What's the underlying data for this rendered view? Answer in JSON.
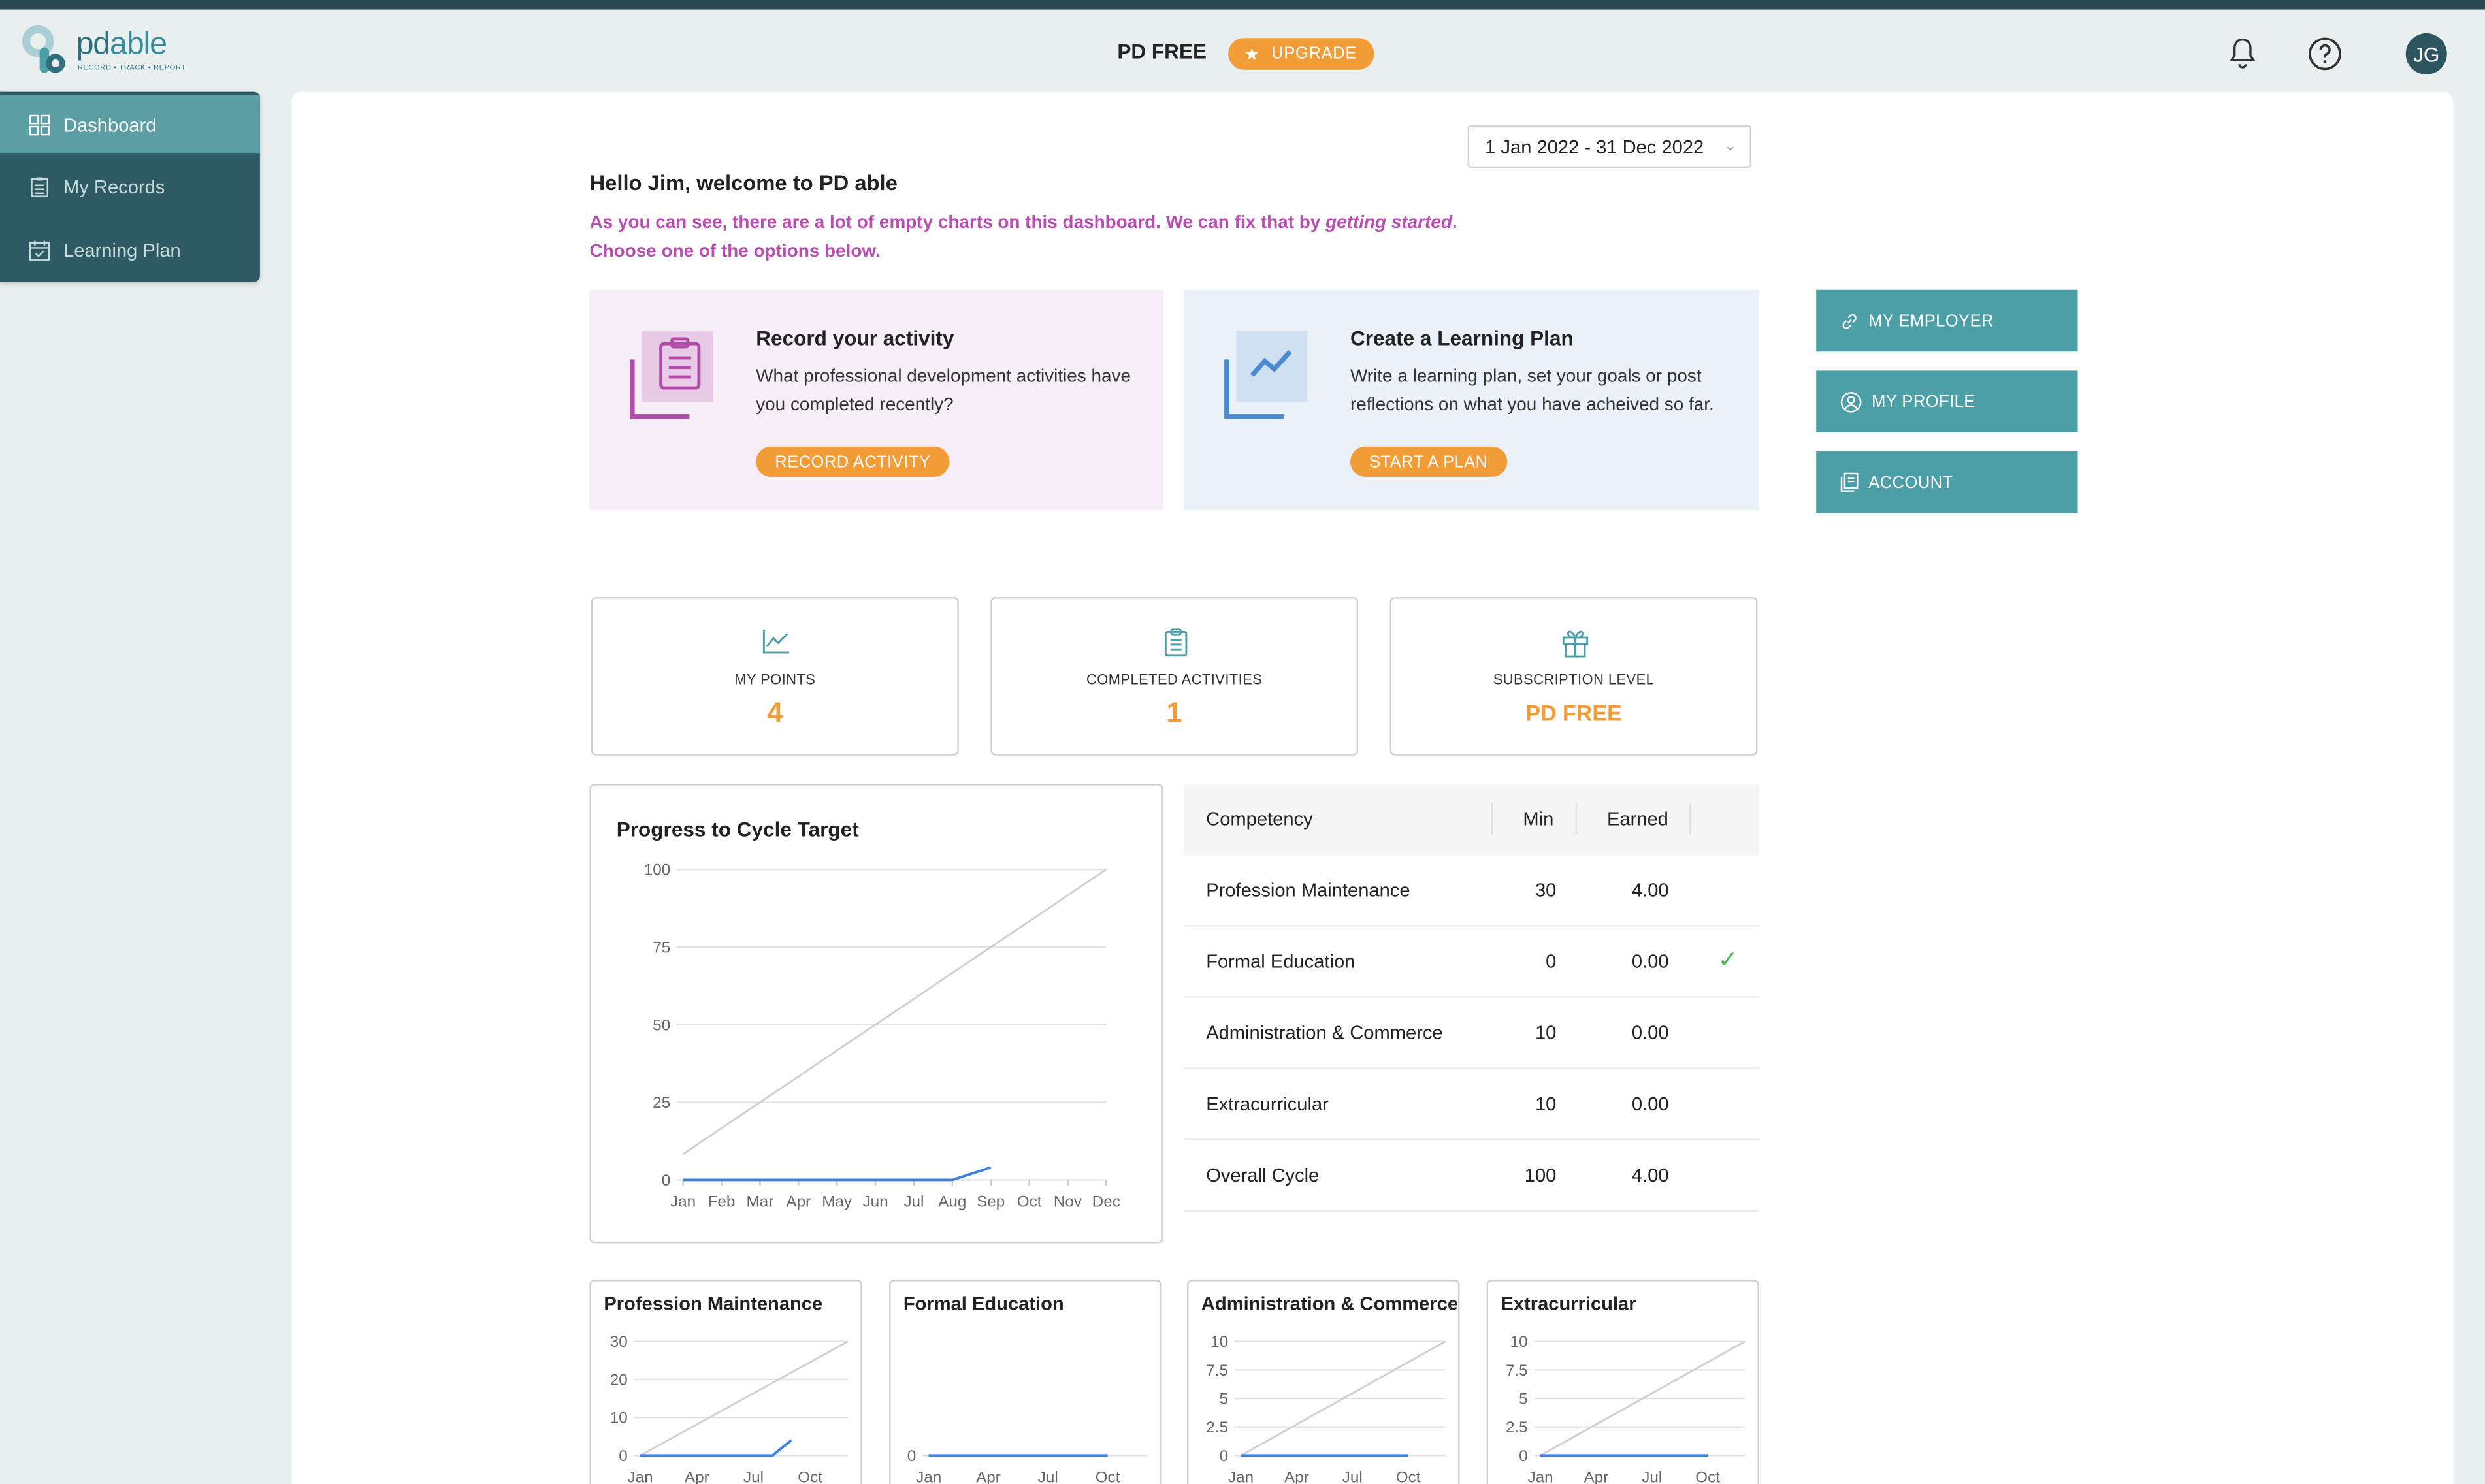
{
  "header": {
    "logo_text_a": "pd",
    "logo_text_b": "able",
    "logo_tagline": "RECORD • TRACK • REPORT",
    "plan_label": "PD FREE",
    "upgrade_label": "UPGRADE",
    "avatar_initials": "JG",
    "icons": [
      "bell-icon",
      "help-icon"
    ]
  },
  "sidebar": {
    "items": [
      {
        "label": "Dashboard",
        "icon": "dashboard-icon",
        "active": true
      },
      {
        "label": "My Records",
        "icon": "records-icon",
        "active": false
      },
      {
        "label": "Learning Plan",
        "icon": "calendar-icon",
        "active": false
      }
    ]
  },
  "main": {
    "date_range": "1 Jan 2022 - 31 Dec 2022",
    "greeting": "Hello Jim, welcome to PD able",
    "intro_line1_a": "As you can see, there are a lot of empty charts on this dashboard. We can fix that by ",
    "intro_line1_em": "getting started",
    "intro_line1_b": ".",
    "intro_line2": "Choose one of the options below."
  },
  "cards": {
    "record": {
      "title": "Record your activity",
      "desc": "What professional development activities have you completed recently?",
      "button": "RECORD ACTIVITY"
    },
    "plan": {
      "title": "Create a Learning Plan",
      "desc": "Write a learning plan, set your goals or post reflections on what you have acheived so far.",
      "button": "START A PLAN"
    }
  },
  "side_buttons": {
    "employer": "MY EMPLOYER",
    "profile": "MY PROFILE",
    "account": "ACCOUNT"
  },
  "stats": {
    "points": {
      "label": "MY POINTS",
      "value": "4"
    },
    "completed": {
      "label": "COMPLETED ACTIVITIES",
      "value": "1"
    },
    "subscription": {
      "label": "SUBSCRIPTION LEVEL",
      "value": "PD FREE"
    }
  },
  "competency_table": {
    "headers": {
      "competency": "Competency",
      "min": "Min",
      "earned": "Earned"
    },
    "rows": [
      {
        "name": "Profession Maintenance",
        "min": "30",
        "earned": "4.00",
        "check": ""
      },
      {
        "name": "Formal Education",
        "min": "0",
        "earned": "0.00",
        "check": "✓"
      },
      {
        "name": "Administration & Commerce",
        "min": "10",
        "earned": "0.00",
        "check": ""
      },
      {
        "name": "Extracurricular",
        "min": "10",
        "earned": "0.00",
        "check": ""
      },
      {
        "name": "Overall Cycle",
        "min": "100",
        "earned": "4.00",
        "check": ""
      }
    ]
  },
  "colors": {
    "accent_orange": "#f29c38",
    "teal": "#4d9fa7",
    "sidebar": "#2d5a63",
    "intro_text": "#b84fb0",
    "earned_line": "#3b7fe0",
    "target_line": "#d0d0d0",
    "check": "#4caf50"
  },
  "chart_data": [
    {
      "type": "line",
      "title": "Progress to Cycle Target",
      "x": [
        "Jan",
        "Feb",
        "Mar",
        "Apr",
        "May",
        "Jun",
        "Jul",
        "Aug",
        "Sep",
        "Oct",
        "Nov",
        "Dec"
      ],
      "yticks": [
        0,
        25,
        50,
        75,
        100
      ],
      "ylim": [
        0,
        100
      ],
      "grid": true,
      "series": [
        {
          "values": [
            8.3,
            16.7,
            25,
            33.3,
            41.7,
            50,
            58.3,
            66.7,
            75,
            83.3,
            91.7,
            100
          ],
          "color": "#d0d0d0"
        },
        {
          "values": [
            0,
            0,
            0,
            0,
            0,
            0,
            0,
            0,
            4
          ],
          "color": "#3b7fe0"
        }
      ]
    },
    {
      "type": "line",
      "title": "Profession Maintenance",
      "x": [
        "Jan",
        "Apr",
        "Jul",
        "Oct"
      ],
      "yticks": [
        0,
        10,
        20,
        30
      ],
      "ylim": [
        0,
        30
      ],
      "series": [
        {
          "values": [
            0,
            30
          ],
          "xrange": [
            0,
            11
          ],
          "color": "#d0d0d0"
        },
        {
          "values": [
            0,
            0,
            0,
            0,
            0,
            0,
            0,
            0,
            4
          ],
          "color": "#3b7fe0"
        }
      ]
    },
    {
      "type": "line",
      "title": "Formal Education",
      "x": [
        "Jan",
        "Apr",
        "Jul",
        "Oct"
      ],
      "yticks": [
        0
      ],
      "ylim": [
        0,
        1
      ],
      "series": [
        {
          "values": [
            0,
            0,
            0,
            0,
            0,
            0,
            0,
            0,
            0,
            0
          ],
          "color": "#3b7fe0"
        }
      ]
    },
    {
      "type": "line",
      "title": "Administration & Commerce",
      "x": [
        "Jan",
        "Apr",
        "Jul",
        "Oct"
      ],
      "yticks": [
        0,
        2.5,
        5,
        7.5,
        10
      ],
      "ylim": [
        0,
        10
      ],
      "series": [
        {
          "values": [
            0,
            10
          ],
          "xrange": [
            0,
            11
          ],
          "color": "#d0d0d0"
        },
        {
          "values": [
            0,
            0,
            0,
            0,
            0,
            0,
            0,
            0,
            0,
            0
          ],
          "color": "#3b7fe0"
        }
      ]
    },
    {
      "type": "line",
      "title": "Extracurricular",
      "x": [
        "Jan",
        "Apr",
        "Jul",
        "Oct"
      ],
      "yticks": [
        0,
        2.5,
        5,
        7.5,
        10
      ],
      "ylim": [
        0,
        10
      ],
      "series": [
        {
          "values": [
            0,
            10
          ],
          "xrange": [
            0,
            11
          ],
          "color": "#d0d0d0"
        },
        {
          "values": [
            0,
            0,
            0,
            0,
            0,
            0,
            0,
            0,
            0,
            0
          ],
          "color": "#3b7fe0"
        }
      ]
    }
  ]
}
